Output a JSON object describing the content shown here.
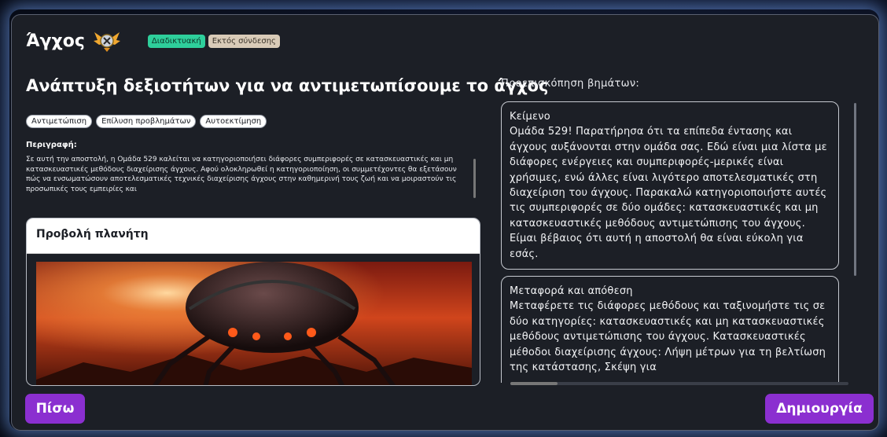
{
  "header": {
    "title": "Άγχος",
    "badges": {
      "online": "Διαδικτυακή",
      "offline": "Εκτός σύνδεσης"
    },
    "colors": {
      "online": "#2ecf9b",
      "offline": "#d9cbb8"
    }
  },
  "mission": {
    "title": "Ανάπτυξη δεξιοτήτων για να αντιμετωπίσουμε το άγχος",
    "tags": [
      "Αντιμετώπιση",
      "Επίλυση προβλημάτων",
      "Αυτοεκτίμηση"
    ],
    "description_label": "Περιγραφή:",
    "description": "Σε αυτή την αποστολή, η Ομάδα 529 καλείται να κατηγοριοποιήσει διάφορες συμπεριφορές σε κατασκευαστικές και μη κατασκευαστικές μεθόδους διαχείρισης άγχους. Αφού ολοκληρωθεί η κατηγοριοποίηση, οι συμμετέχοντες θα εξετάσουν πώς να ενσωματώσουν αποτελεσματικές τεχνικές διαχείρισης άγχους στην καθημερινή τους ζωή και να μοιραστούν τις προσωπικές τους εμπειρίες και"
  },
  "planet_view": {
    "title": "Προβολή πλανήτη"
  },
  "preview": {
    "label": "Προεπισκόπηση βημάτων:",
    "steps": [
      {
        "title": "Κείμενο",
        "body": "Ομάδα 529! Παρατήρησα ότι τα επίπεδα έντασης και άγχους αυξάνονται στην ομάδα σας. Εδώ είναι μια λίστα με διάφορες ενέργειες και συμπεριφορές-μερικές είναι χρήσιμες, ενώ άλλες είναι λιγότερο αποτελεσματικές στη διαχείριση του άγχους. Παρακαλώ κατηγοριοποιήστε αυτές τις συμπεριφορές σε δύο ομάδες: κατασκευαστικές και μη κατασκευαστικές μεθόδους αντιμετώπισης του άγχους. Είμαι βέβαιος ότι αυτή η αποστολή θα είναι εύκολη για εσάς."
      },
      {
        "title": "Μεταφορά και απόθεση",
        "body": "Μεταφέρετε τις διάφορες μεθόδους και ταξινομήστε τις σε δύο κατηγορίες: κατασκευαστικές και μη κατασκευαστικές μεθόδους αντιμετώπισης του άγχους. Κατασκευαστικές μέθοδοι διαχείρισης άγχους: Λήψη μέτρων για τη βελτίωση της κατάστασης, Σκέψη για"
      }
    ]
  },
  "footer": {
    "back_label": "Πίσω",
    "create_label": "Δημιουργία"
  },
  "colors": {
    "accent": "#8b2fd0",
    "panel": "#1c1f26"
  },
  "icons": {
    "emblem": "winged-emblem-icon"
  }
}
